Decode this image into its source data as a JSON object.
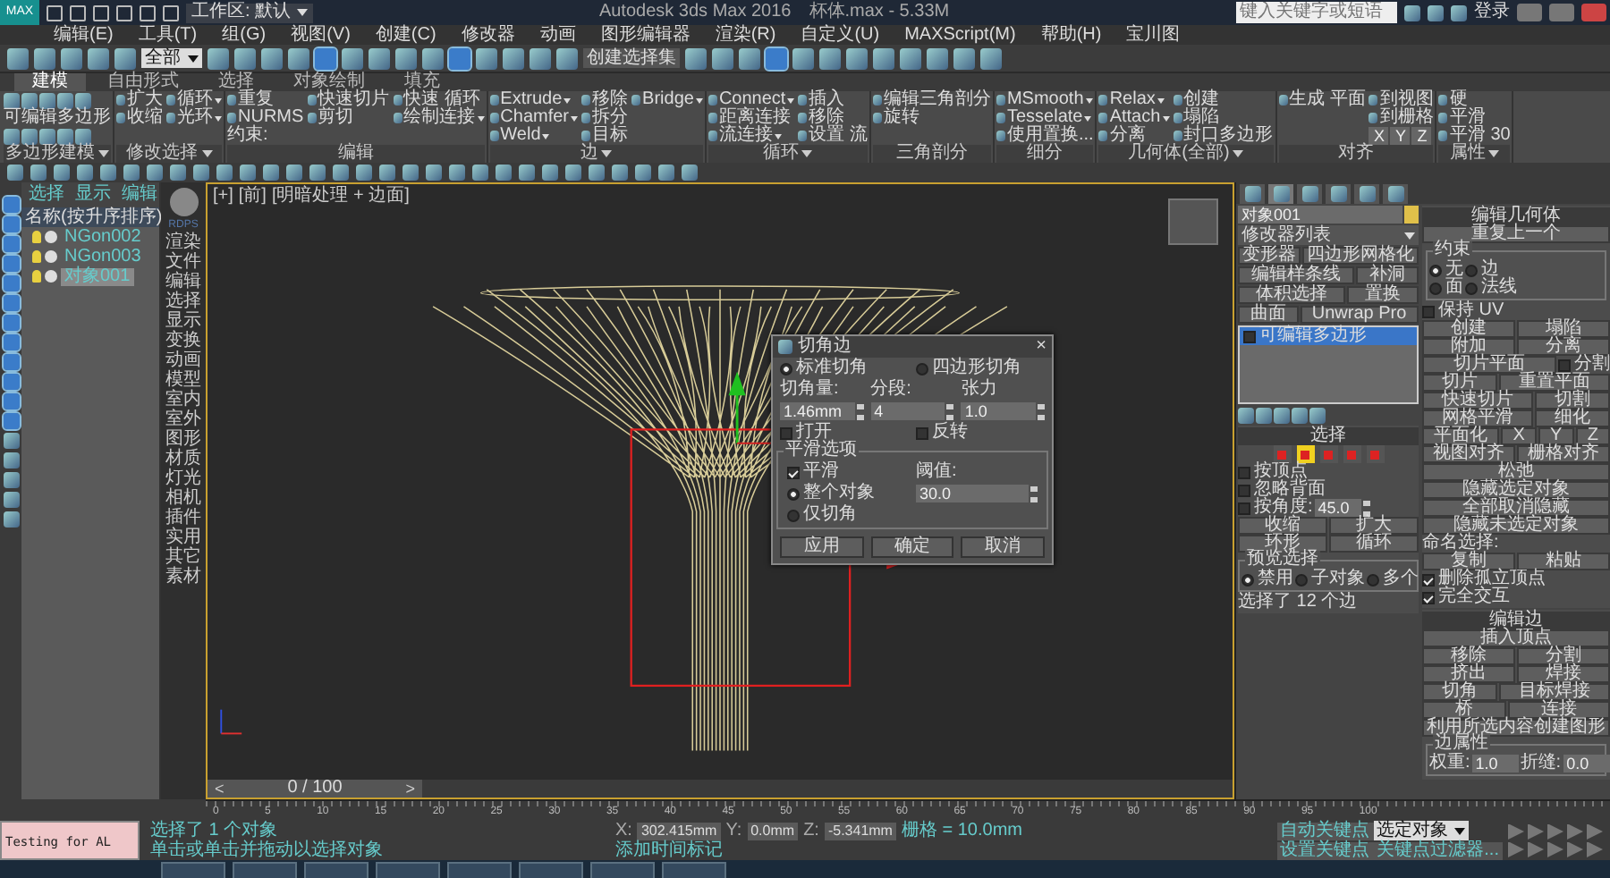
{
  "title_bar": {
    "logo": "MAX",
    "workspace": "工作区: 默认",
    "title": "Autodesk 3ds Max 2016",
    "file": "杯体.max - 5.33M",
    "search_placeholder": "键入关键字或短语",
    "sign_in": "登录"
  },
  "menu": [
    "编辑(E)",
    "工具(T)",
    "组(G)",
    "视图(V)",
    "创建(C)",
    "修改器",
    "动画",
    "图形编辑器",
    "渲染(R)",
    "自定义(U)",
    "MAXScript(M)",
    "帮助(H)",
    "宝川图"
  ],
  "toolbar": {
    "filter": "全部",
    "selection_set": "创建选择集"
  },
  "ribbon_tabs": [
    {
      "label": "建模",
      "selected": true
    },
    {
      "label": "自由形式",
      "selected": false
    },
    {
      "label": "选择",
      "selected": false
    },
    {
      "label": "对象绘制",
      "selected": false
    },
    {
      "label": "填充",
      "selected": false
    }
  ],
  "ribbon_groups": [
    {
      "label": "多边形建模",
      "menu": true,
      "columns": [
        [
          {
            "kind": "icons"
          },
          {
            "kind": "label",
            "text": "可编辑多边形"
          },
          {
            "kind": "icons"
          }
        ]
      ]
    },
    {
      "label": "修改选择",
      "menu": true,
      "columns": [
        [
          {
            "kind": "tool",
            "label": "扩大",
            "menu": false
          },
          {
            "kind": "tool",
            "label": "收缩",
            "menu": false
          }
        ],
        [
          {
            "kind": "tool",
            "label": "循环",
            "menu": true
          },
          {
            "kind": "tool",
            "label": "光环",
            "menu": true
          }
        ]
      ]
    },
    {
      "label": "编辑",
      "menu": false,
      "columns": [
        [
          {
            "kind": "tool",
            "label": "重复",
            "menu": false
          },
          {
            "kind": "tool",
            "label": "NURMS",
            "menu": false
          },
          {
            "kind": "label",
            "text": "约束:"
          }
        ],
        [
          {
            "kind": "tool",
            "label": "快速切片",
            "menu": false
          },
          {
            "kind": "tool",
            "label": "剪切",
            "menu": false
          }
        ],
        [
          {
            "kind": "tool",
            "label": "快速 循环",
            "menu": false
          },
          {
            "kind": "tool",
            "label": "绘制连接",
            "menu": true
          }
        ]
      ]
    },
    {
      "label": "边",
      "menu": true,
      "columns": [
        [
          {
            "kind": "tool",
            "label": "Extrude",
            "menu": true
          },
          {
            "kind": "tool",
            "label": "Chamfer",
            "menu": true
          },
          {
            "kind": "tool",
            "label": "Weld",
            "menu": true
          }
        ],
        [
          {
            "kind": "tool",
            "label": "移除",
            "menu": false
          },
          {
            "kind": "tool",
            "label": "拆分",
            "menu": false
          },
          {
            "kind": "tool",
            "label": "目标",
            "menu": false
          }
        ],
        [
          {
            "kind": "tool",
            "label": "Bridge",
            "menu": true
          }
        ]
      ]
    },
    {
      "label": "循环",
      "menu": true,
      "columns": [
        [
          {
            "kind": "tool",
            "label": "Connect",
            "menu": true
          },
          {
            "kind": "tool",
            "label": "距离连接",
            "menu": false
          },
          {
            "kind": "tool",
            "label": "流连接",
            "menu": true
          }
        ],
        [
          {
            "kind": "tool",
            "label": "插入",
            "menu": false
          },
          {
            "kind": "tool",
            "label": "移除",
            "menu": false
          },
          {
            "kind": "tool",
            "label": "设置 流",
            "menu": false
          }
        ]
      ]
    },
    {
      "label": "三角剖分",
      "menu": false,
      "columns": [
        [
          {
            "kind": "tool",
            "label": "编辑三角剖分",
            "menu": false
          },
          {
            "kind": "tool",
            "label": "旋转",
            "menu": false
          }
        ]
      ]
    },
    {
      "label": "细分",
      "menu": false,
      "columns": [
        [
          {
            "kind": "tool",
            "label": "MSmooth",
            "menu": true
          },
          {
            "kind": "tool",
            "label": "Tesselate",
            "menu": true
          },
          {
            "kind": "tool",
            "label": "使用置换...",
            "menu": false
          }
        ]
      ]
    },
    {
      "label": "几何体(全部)",
      "menu": true,
      "columns": [
        [
          {
            "kind": "tool",
            "label": "Relax",
            "menu": true
          },
          {
            "kind": "tool",
            "label": "Attach",
            "menu": true
          },
          {
            "kind": "tool",
            "label": "分离",
            "menu": false
          }
        ],
        [
          {
            "kind": "tool",
            "label": "创建",
            "menu": false
          },
          {
            "kind": "tool",
            "label": "塌陷",
            "menu": false
          },
          {
            "kind": "tool",
            "label": "封口多边形",
            "menu": false
          }
        ]
      ]
    },
    {
      "label": "对齐",
      "menu": false,
      "columns": [
        [
          {
            "kind": "tool",
            "label": "生成 平面",
            "menu": false
          }
        ],
        [
          {
            "kind": "tool",
            "label": "到视图",
            "menu": false
          },
          {
            "kind": "tool",
            "label": "到栅格",
            "menu": false
          },
          {
            "kind": "axes",
            "labels": [
              "X",
              "Y",
              "Z"
            ]
          }
        ]
      ]
    },
    {
      "label": "属性",
      "menu": true,
      "columns": [
        [
          {
            "kind": "tool",
            "label": "硬",
            "menu": false
          },
          {
            "kind": "tool",
            "label": "平滑",
            "menu": false
          },
          {
            "kind": "tool",
            "label": "平滑 30",
            "menu": false
          }
        ]
      ]
    }
  ],
  "explorer": {
    "tabs": [
      "选择",
      "显示",
      "编辑"
    ],
    "header": "名称(按升序排序)",
    "items": [
      {
        "label": "NGon002",
        "selected": false
      },
      {
        "label": "NGon003",
        "selected": false
      },
      {
        "label": "对象001",
        "selected": true
      }
    ]
  },
  "categories": {
    "badge": "RDPS",
    "items": [
      "渲染",
      "文件",
      "编辑",
      "选择",
      "显示",
      "变换",
      "动画",
      "模型",
      "室内",
      "室外",
      "图形",
      "材质",
      "灯光",
      "相机",
      "插件",
      "实用",
      "其它",
      "素材"
    ]
  },
  "viewport": {
    "labels": [
      "[+]",
      "[前]",
      "[明暗处理 + 边面]"
    ],
    "time_slider": {
      "label": "0 / 100",
      "prev": "<",
      "next": ">",
      "level": 0
    }
  },
  "dialog": {
    "title": "切角边",
    "close": "×",
    "rows": [
      [
        {
          "kind": "radio",
          "label": "标准切角",
          "selected": true
        },
        {
          "kind": "radio",
          "label": "四边形切角",
          "selected": false
        }
      ],
      [
        {
          "kind": "label",
          "text": "切角量:"
        },
        {
          "kind": "label",
          "text": "分段:"
        },
        {
          "kind": "label",
          "text": "张力"
        }
      ],
      [
        {
          "kind": "spinner",
          "value": "1.46mm"
        },
        {
          "kind": "spinner",
          "value": "4"
        },
        {
          "kind": "spinner",
          "value": "1.0"
        }
      ],
      [
        {
          "kind": "check",
          "label": "打开",
          "checked": false
        },
        {
          "kind": "check",
          "label": "反转",
          "checked": false
        }
      ]
    ],
    "group": {
      "title": "平滑选项",
      "rows": [
        [
          {
            "kind": "check",
            "label": "平滑",
            "checked": true
          },
          {
            "kind": "label",
            "text": "阈值:"
          }
        ],
        [
          {
            "kind": "radio",
            "label": "整个对象",
            "selected": true
          },
          {
            "kind": "spinner",
            "value": "30.0"
          }
        ],
        [
          {
            "kind": "radio",
            "label": "仅切角",
            "selected": false
          }
        ]
      ]
    },
    "buttons": [
      "应用",
      "确定",
      "取消"
    ]
  },
  "command_tabs": [
    {
      "selected": false
    },
    {
      "selected": true
    },
    {
      "selected": false
    },
    {
      "selected": false
    },
    {
      "selected": false
    },
    {
      "selected": false
    }
  ],
  "modify_panel": {
    "object_name": "对象001",
    "modifier_list": "修改器列表",
    "modifier_buttons": [
      "变形器",
      "四边形网格化",
      "编辑样条线",
      "补洞",
      "体积选择",
      "置换",
      "曲面",
      "Unwrap Pro"
    ],
    "stack": [
      {
        "label": "可编辑多边形",
        "selected": true
      }
    ],
    "selection": {
      "title": "选择",
      "subobjects": [
        {
          "selected": false
        },
        {
          "selected": true
        },
        {
          "selected": false
        },
        {
          "selected": false
        },
        {
          "selected": false
        }
      ],
      "rows": [
        [
          {
            "kind": "check",
            "label": "按顶点",
            "checked": false
          }
        ],
        [
          {
            "kind": "check",
            "label": "忽略背面",
            "checked": false
          }
        ],
        [
          {
            "kind": "check",
            "label": "按角度:",
            "checked": false
          },
          {
            "kind": "spinner",
            "value": "45.0"
          }
        ],
        [
          {
            "kind": "button",
            "label": "收缩"
          },
          {
            "kind": "button",
            "label": "扩大"
          }
        ],
        [
          {
            "kind": "button",
            "label": "环形"
          },
          {
            "kind": "button",
            "label": "循环"
          }
        ],
        {
          "group": "预览选择",
          "rows": [
            [
              {
                "kind": "radio",
                "label": "禁用",
                "selected": true
              },
              {
                "kind": "radio",
                "label": "子对象",
                "selected": false
              },
              {
                "kind": "radio",
                "label": "多个",
                "selected": false
              }
            ]
          ]
        },
        [
          {
            "kind": "label",
            "text": "选择了 12 个边"
          }
        ]
      ]
    }
  },
  "edit_geometry": {
    "title": "编辑几何体",
    "rows": [
      [
        {
          "kind": "button",
          "label": "重复上一个"
        }
      ],
      {
        "group": "约束",
        "rows": [
          [
            {
              "kind": "radio",
              "label": "无",
              "selected": true
            },
            {
              "kind": "radio",
              "label": "边",
              "selected": false
            }
          ],
          [
            {
              "kind": "radio",
              "label": "面",
              "selected": false
            },
            {
              "kind": "radio",
              "label": "法线",
              "selected": false
            }
          ]
        ]
      },
      [
        {
          "kind": "check",
          "label": "保持 UV",
          "checked": false
        }
      ],
      [
        {
          "kind": "button",
          "label": "创建"
        },
        {
          "kind": "button",
          "label": "塌陷"
        }
      ],
      [
        {
          "kind": "button",
          "label": "附加"
        },
        {
          "kind": "button",
          "label": "分离"
        }
      ],
      [
        {
          "kind": "button",
          "label": "切片平面"
        },
        {
          "kind": "check",
          "label": "分割",
          "checked": false
        }
      ],
      [
        {
          "kind": "button",
          "label": "切片"
        },
        {
          "kind": "button",
          "label": "重置平面"
        }
      ],
      [
        {
          "kind": "button",
          "label": "快速切片"
        },
        {
          "kind": "button",
          "label": "切割"
        }
      ],
      [
        {
          "kind": "button",
          "label": "网格平滑"
        },
        {
          "kind": "button",
          "label": "细化"
        }
      ],
      [
        {
          "kind": "button",
          "label": "平面化"
        },
        {
          "kind": "button",
          "label": "X"
        },
        {
          "kind": "button",
          "label": "Y"
        },
        {
          "kind": "button",
          "label": "Z"
        }
      ],
      [
        {
          "kind": "button",
          "label": "视图对齐"
        },
        {
          "kind": "button",
          "label": "栅格对齐"
        }
      ],
      [
        {
          "kind": "button",
          "label": "松弛"
        }
      ],
      [
        {
          "kind": "button",
          "label": "隐藏选定对象"
        }
      ],
      [
        {
          "kind": "button",
          "label": "全部取消隐藏"
        }
      ],
      [
        {
          "kind": "button",
          "label": "隐藏未选定对象"
        }
      ],
      [
        {
          "kind": "label",
          "text": "命名选择:"
        }
      ],
      [
        {
          "kind": "button",
          "label": "复制"
        },
        {
          "kind": "button",
          "label": "粘贴"
        }
      ],
      [
        {
          "kind": "check",
          "label": "删除孤立顶点",
          "checked": true
        }
      ],
      [
        {
          "kind": "check",
          "label": "完全交互",
          "checked": true
        }
      ]
    ]
  },
  "edit_edges": {
    "title": "编辑边",
    "rows": [
      [
        {
          "kind": "button",
          "label": "插入顶点"
        }
      ],
      [
        {
          "kind": "button",
          "label": "移除"
        },
        {
          "kind": "button",
          "label": "分割"
        }
      ],
      [
        {
          "kind": "button",
          "label": "挤出"
        },
        {
          "kind": "button",
          "label": "焊接"
        }
      ],
      [
        {
          "kind": "button",
          "label": "切角"
        },
        {
          "kind": "button",
          "label": "目标焊接"
        }
      ],
      [
        {
          "kind": "button",
          "label": "桥"
        },
        {
          "kind": "button",
          "label": "连接"
        }
      ],
      [
        {
          "kind": "button",
          "label": "利用所选内容创建图形"
        }
      ],
      {
        "group": "边属性",
        "rows": [
          [
            {
              "kind": "label",
              "text": "权重:"
            },
            {
              "kind": "field",
              "value": "1.0"
            },
            {
              "kind": "label",
              "text": "折缝:"
            },
            {
              "kind": "field",
              "value": "0.0"
            }
          ]
        ]
      }
    ]
  },
  "ruler_labels": [
    "0",
    "5",
    "10",
    "15",
    "20",
    "25",
    "30",
    "35",
    "40",
    "45",
    "50",
    "55",
    "60",
    "65",
    "70",
    "75",
    "80",
    "85",
    "90",
    "95",
    "100"
  ],
  "status_bar": {
    "listener": "Testing for AL",
    "messages": [
      "选择了 1 个对象",
      "单击或单击并拖动以选择对象"
    ],
    "coords": [
      {
        "axis": "X:",
        "value": "302.415mm"
      },
      {
        "axis": "Y:",
        "value": "0.0mm"
      },
      {
        "axis": "Z:",
        "value": "-5.341mm"
      }
    ],
    "grid": "栅格 = 10.0mm",
    "add_time_tag": "添加时间标记",
    "auto_key": "自动关键点",
    "key_mode": "选定对象",
    "set_key": "设置关键点",
    "key_filters": "关键点过滤器..."
  }
}
